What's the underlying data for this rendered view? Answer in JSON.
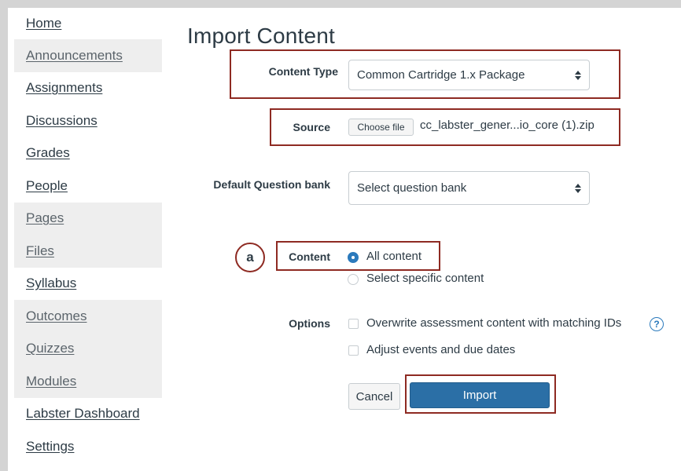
{
  "sidebar": {
    "items": [
      {
        "label": "Home",
        "shaded": false
      },
      {
        "label": "Announcements",
        "shaded": true
      },
      {
        "label": "Assignments",
        "shaded": false
      },
      {
        "label": "Discussions",
        "shaded": false
      },
      {
        "label": "Grades",
        "shaded": false
      },
      {
        "label": "People",
        "shaded": false
      },
      {
        "label": "Pages",
        "shaded": true
      },
      {
        "label": "Files",
        "shaded": true
      },
      {
        "label": "Syllabus",
        "shaded": false
      },
      {
        "label": "Outcomes",
        "shaded": true
      },
      {
        "label": "Quizzes",
        "shaded": true
      },
      {
        "label": "Modules",
        "shaded": true
      },
      {
        "label": "Labster Dashboard",
        "shaded": false
      },
      {
        "label": "Settings",
        "shaded": false
      }
    ]
  },
  "page": {
    "title": "Import Content"
  },
  "form": {
    "content_type": {
      "label": "Content Type",
      "value": "Common Cartridge 1.x Package"
    },
    "source": {
      "label": "Source",
      "button": "Choose file",
      "file_name": "cc_labster_gener...io_core (1).zip"
    },
    "question_bank": {
      "label": "Default Question bank",
      "value": "Select question bank"
    },
    "content": {
      "label": "Content",
      "callout": "a",
      "options": [
        {
          "label": "All content",
          "checked": true
        },
        {
          "label": "Select specific content",
          "checked": false
        }
      ]
    },
    "options": {
      "label": "Options",
      "items": [
        {
          "label": "Overwrite assessment content with matching IDs",
          "checked": false
        },
        {
          "label": "Adjust events and due dates",
          "checked": false
        }
      ],
      "help_glyph": "?"
    },
    "actions": {
      "cancel": "Cancel",
      "import": "Import"
    }
  },
  "colors": {
    "highlight": "#8e2a22",
    "primary": "#2b6fa6",
    "radio_checked": "#2b7abc"
  }
}
